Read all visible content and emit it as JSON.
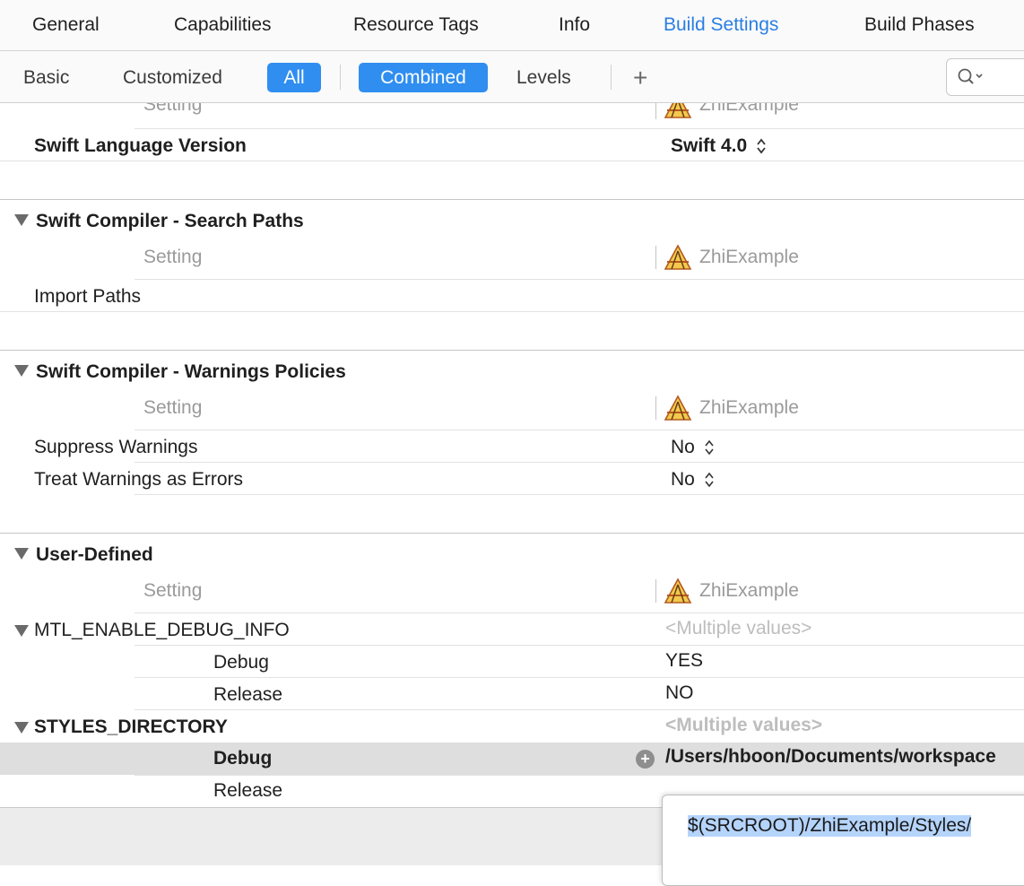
{
  "tabs": {
    "general": "General",
    "capabilities": "Capabilities",
    "resource_tags": "Resource Tags",
    "info": "Info",
    "build_settings": "Build Settings",
    "build_phases": "Build Phases"
  },
  "filters": {
    "basic": "Basic",
    "customized": "Customized",
    "all": "All",
    "combined": "Combined",
    "levels": "Levels",
    "add": "+"
  },
  "colors": {
    "accent": "#2f8ef0",
    "active_tab": "#2a7ee4"
  },
  "target_name": "ZhiExample",
  "setting_header": "Setting",
  "swift_language_version": {
    "label": "Swift Language Version",
    "value": "Swift 4.0"
  },
  "sections": {
    "search_paths": {
      "title": "Swift Compiler - Search Paths",
      "import_paths": "Import Paths"
    },
    "warnings": {
      "title": "Swift Compiler - Warnings Policies",
      "suppress": {
        "label": "Suppress Warnings",
        "value": "No"
      },
      "treat_as_errors": {
        "label": "Treat Warnings as Errors",
        "value": "No"
      }
    },
    "user_defined": {
      "title": "User-Defined",
      "mtl": {
        "label": "MTL_ENABLE_DEBUG_INFO",
        "value": "<Multiple values>",
        "debug": {
          "label": "Debug",
          "value": "YES"
        },
        "release": {
          "label": "Release",
          "value": "NO"
        }
      },
      "styles": {
        "label": "STYLES_DIRECTORY",
        "value": "<Multiple values>",
        "debug": {
          "label": "Debug",
          "value": "/Users/hboon/Documents/workspace"
        },
        "release": {
          "label": "Release"
        }
      }
    }
  },
  "popup": {
    "value": "$(SRCROOT)/ZhiExample/Styles/"
  }
}
